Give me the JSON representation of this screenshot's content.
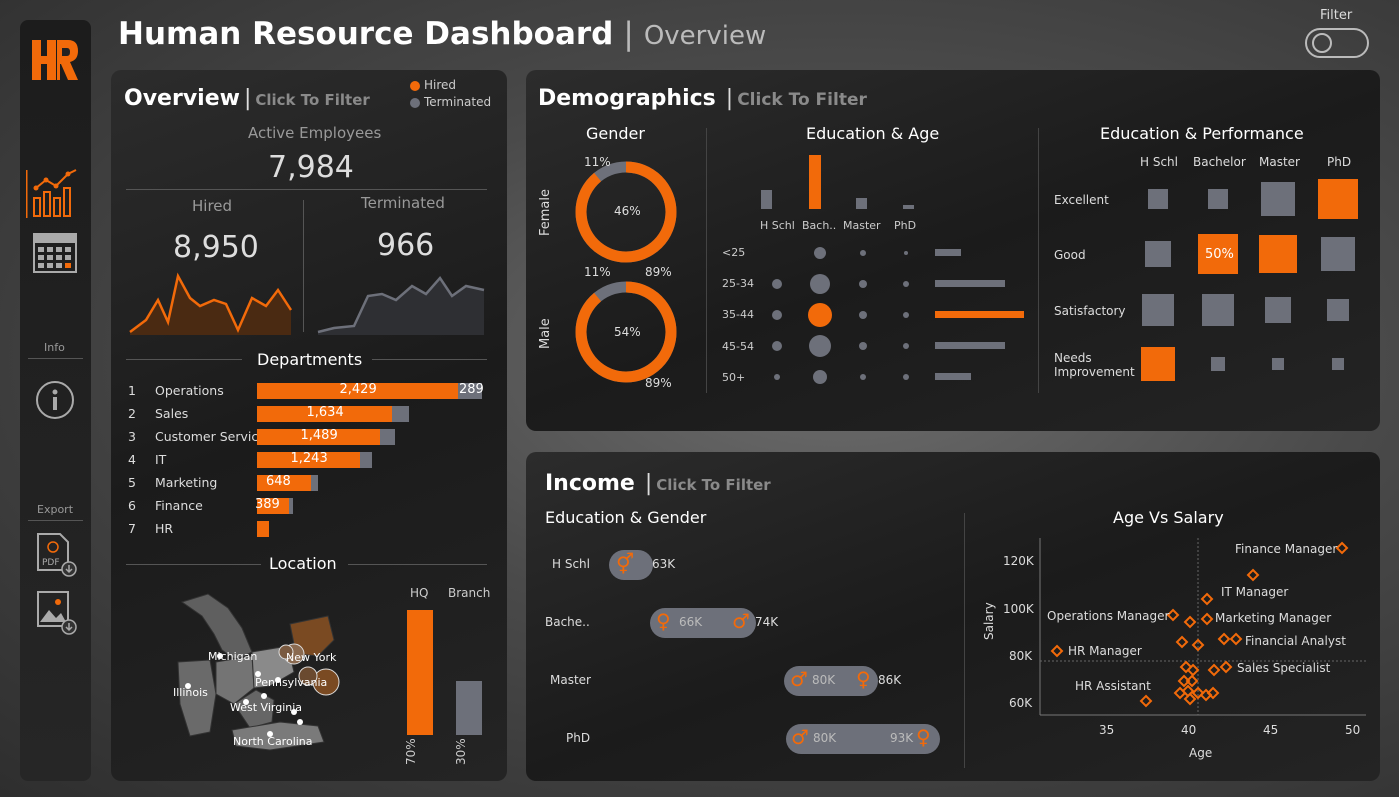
{
  "header": {
    "title": "Human Resource Dashboard",
    "separator": "|",
    "subtitle": "Overview",
    "filter_label": "Filter"
  },
  "sidebar": {
    "logo": "HR",
    "info_label": "Info",
    "export_label": "Export",
    "icons": [
      "chart-icon",
      "calendar-icon",
      "info-icon",
      "pdf-icon",
      "image-icon"
    ]
  },
  "overview": {
    "title": "Overview",
    "bar": "|",
    "click_filter": "Click To Filter",
    "legend": {
      "hired": "Hired",
      "terminated": "Terminated"
    },
    "active_label": "Active Employees",
    "active_value": "7,984",
    "hired_label": "Hired",
    "hired_value": "8,950",
    "terminated_label": "Terminated",
    "terminated_value": "966",
    "departments_label": "Departments",
    "departments": [
      {
        "rank": "1",
        "name": "Operations",
        "hired": "2,429",
        "terminated": "289",
        "hired_n": 2429,
        "term_n": 289
      },
      {
        "rank": "2",
        "name": "Sales",
        "hired": "1,634",
        "terminated": "",
        "hired_n": 1634,
        "term_n": 200
      },
      {
        "rank": "3",
        "name": "Customer Service",
        "hired": "1,489",
        "terminated": "",
        "hired_n": 1489,
        "term_n": 180
      },
      {
        "rank": "4",
        "name": "IT",
        "hired": "1,243",
        "terminated": "",
        "hired_n": 1243,
        "term_n": 150
      },
      {
        "rank": "5",
        "name": "Marketing",
        "hired": "648",
        "terminated": "",
        "hired_n": 648,
        "term_n": 80
      },
      {
        "rank": "6",
        "name": "Finance",
        "hired": "389",
        "terminated": "",
        "hired_n": 389,
        "term_n": 50
      },
      {
        "rank": "7",
        "name": "HR",
        "hired": "",
        "terminated": "",
        "hired_n": 150,
        "term_n": 0
      }
    ],
    "location_label": "Location",
    "states": [
      "Michigan",
      "New York",
      "Pennsylvania",
      "Illinois",
      "West Virginia",
      "North Carolina"
    ],
    "hq_label": "HQ",
    "branch_label": "Branch",
    "hq_pct": "70%",
    "branch_pct": "30%",
    "hq_share": 0.7,
    "branch_share": 0.3
  },
  "demographics": {
    "title": "Demographics",
    "bar": "|",
    "click_filter": "Click To Filter",
    "gender_label": "Gender",
    "female": {
      "label": "Female",
      "pct": "46%",
      "inner_top": "11%",
      "share": 0.89
    },
    "male": {
      "label": "Male",
      "pct": "54%",
      "top_left": "11%",
      "top_right": "89%",
      "bottom": "89%",
      "share": 0.89
    },
    "edu_age_label": "Education & Age",
    "edu_levels": [
      "H Schl",
      "Bach..",
      "Master",
      "PhD"
    ],
    "edu_counts": [
      0.35,
      1.0,
      0.2,
      0.08
    ],
    "age_groups": [
      "<25",
      "25-34",
      "35-44",
      "45-54",
      "50+"
    ],
    "age_bars": [
      0.35,
      0.95,
      1.2,
      0.95,
      0.48
    ],
    "edu_perf_label": "Education & Performance",
    "perf_cols": [
      "H Schl",
      "Bachelor",
      "Master",
      "PhD"
    ],
    "perf_rows": [
      "Excellent",
      "Good",
      "Satisfactory",
      "Needs Improvement"
    ],
    "perf_cell_text": "50%"
  },
  "income": {
    "title": "Income",
    "bar": "|",
    "click_filter": "Click To Filter",
    "edu_gender_label": "Education & Gender",
    "rows": [
      {
        "edu": "H Schl",
        "female": "",
        "male": "63K"
      },
      {
        "edu": "Bache..",
        "female": "66K",
        "male": "74K"
      },
      {
        "edu": "Master",
        "female": "86K",
        "male": "80K"
      },
      {
        "edu": "PhD",
        "female": "93K",
        "male": "80K"
      }
    ],
    "age_salary_label": "Age Vs Salary",
    "y_label": "Salary",
    "x_label": "Age",
    "y_ticks": [
      "120K",
      "100K",
      "80K",
      "60K"
    ],
    "x_ticks": [
      "35",
      "40",
      "45",
      "50"
    ],
    "job_labels": [
      "Finance Manager",
      "IT Manager",
      "Operations Manager",
      "Marketing Manager",
      "Financial Analyst",
      "HR Manager",
      "Sales Specialist",
      "HR Assistant"
    ]
  },
  "colors": {
    "accent": "#f26a0a",
    "grey": "#6d707a",
    "panel": "#1f1f1f"
  }
}
